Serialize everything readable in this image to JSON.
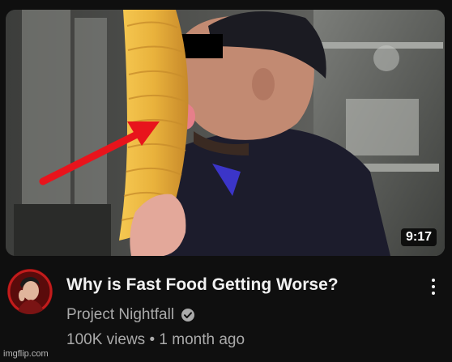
{
  "video": {
    "title": "Why is Fast Food Getting Worse?",
    "duration": "9:17",
    "channel": "Project Nightfall",
    "views": "100K views",
    "age": "1 month ago",
    "separator": "•"
  },
  "icons": {
    "verified": "verified-check-icon",
    "more": "more-vert-icon"
  },
  "watermark": "imgflip.com",
  "colors": {
    "background": "#0f0f0f",
    "title": "#f1f1f1",
    "meta": "#aaaaaa",
    "arrow": "#e8141c",
    "taco": "#e7b040"
  }
}
